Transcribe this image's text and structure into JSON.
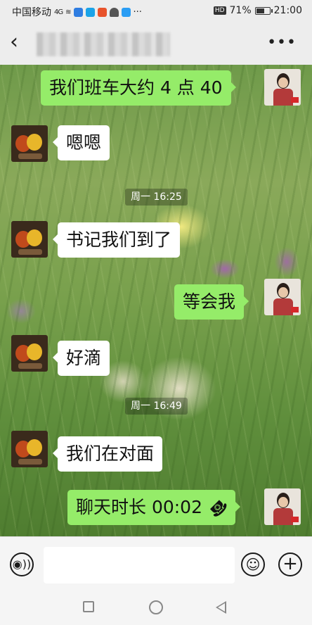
{
  "status_bar": {
    "carrier": "中国移动",
    "signal": "4G",
    "battery": "71%",
    "battery_level": 0.71,
    "time": "21:00"
  },
  "header": {
    "back_icon": "chevron-left-icon",
    "more_icon": "more-icon",
    "title_blurred": true
  },
  "messages": [
    {
      "side": "out",
      "text": "我们班车大约 4 点 40"
    },
    {
      "side": "in",
      "text": "嗯嗯"
    },
    {
      "type": "time",
      "text": "周一 16:25"
    },
    {
      "side": "in",
      "text": "书记我们到了"
    },
    {
      "side": "out",
      "text": "等会我"
    },
    {
      "side": "in",
      "text": "好滴"
    },
    {
      "type": "time",
      "text": "周一 16:49"
    },
    {
      "side": "in",
      "text": "我们在对面"
    },
    {
      "side": "out",
      "text": "聊天时长 00:02",
      "icon": "phone-hangup-icon"
    }
  ],
  "input_bar": {
    "voice_icon": "voice-icon",
    "emoji_icon": "emoji-icon",
    "plus_icon": "plus-icon",
    "placeholder": ""
  }
}
